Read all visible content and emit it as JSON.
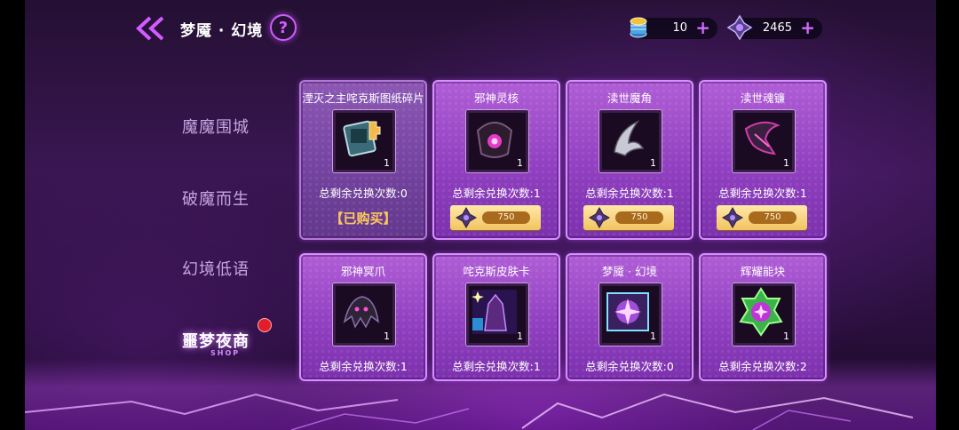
{
  "header": {
    "title": "梦魇 · 幻境",
    "help_label": "?"
  },
  "currencies": [
    {
      "icon": "coin-stack-icon",
      "value": "10",
      "plus": "+"
    },
    {
      "icon": "dark-crystal-icon",
      "value": "2465",
      "plus": "+"
    }
  ],
  "tabs": [
    {
      "label": "魔魔围城",
      "active": false
    },
    {
      "label": "破魔而生",
      "active": false
    },
    {
      "label": "幻境低语",
      "active": false
    },
    {
      "label": "噩梦夜商",
      "active": true,
      "sub": "SHOP",
      "badge": true
    }
  ],
  "shop": {
    "items": [
      {
        "name": "湮灭之主咤克斯图纸碎片",
        "qty": "1",
        "remaining": "总剩余兑换次数:0",
        "status": "【已购买】",
        "price": null,
        "icon": "blueprint-fragment-icon"
      },
      {
        "name": "邪神灵核",
        "qty": "1",
        "remaining": "总剩余兑换次数:1",
        "status": null,
        "price": "750",
        "icon": "evil-core-icon"
      },
      {
        "name": "渎世魔角",
        "qty": "1",
        "remaining": "总剩余兑换次数:1",
        "status": null,
        "price": "750",
        "icon": "demon-horn-icon"
      },
      {
        "name": "渎世魂镰",
        "qty": "1",
        "remaining": "总剩余兑换次数:1",
        "status": null,
        "price": "750",
        "icon": "soul-scythe-icon"
      },
      {
        "name": "邪神冥爪",
        "qty": "1",
        "remaining": "总剩余兑换次数:1",
        "status": null,
        "price": null,
        "icon": "nether-claw-icon"
      },
      {
        "name": "咤克斯皮肤卡",
        "qty": "1",
        "remaining": "总剩余兑换次数:1",
        "status": null,
        "price": null,
        "icon": "skin-card-icon"
      },
      {
        "name": "梦魇 · 幻境",
        "qty": "1",
        "remaining": "总剩余兑换次数:0",
        "status": null,
        "price": null,
        "icon": "nightmare-realm-icon"
      },
      {
        "name": "辉耀能块",
        "qty": "1",
        "remaining": "总剩余兑换次数:2",
        "status": null,
        "price": null,
        "icon": "radiant-block-icon"
      }
    ]
  },
  "colors": {
    "accent": "#d25bff",
    "price_pill": "#a86a1d",
    "bought_text": "#ffc95a",
    "badge": "#e21d2c"
  }
}
